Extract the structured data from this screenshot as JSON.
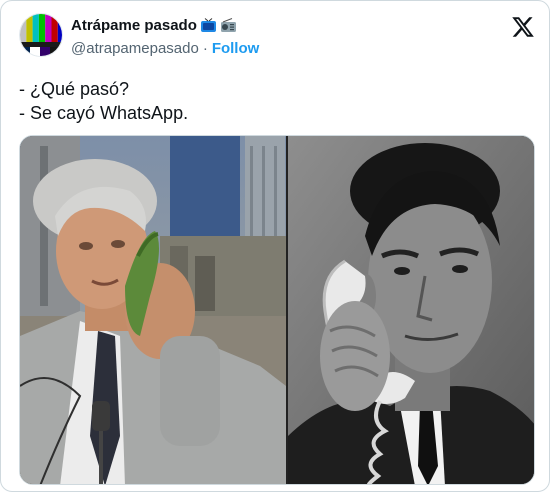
{
  "tweet": {
    "display_name": "Atrápame pasado",
    "name_emojis": [
      "tv-emoji",
      "radio-emoji"
    ],
    "handle": "@atrapamepasado",
    "separator": "·",
    "follow_label": "Follow",
    "lines": [
      "- ¿Qué pasó?",
      "- Se cayó WhatsApp."
    ]
  },
  "colors": {
    "accent": "#1d9bf0",
    "text": "#0f1419",
    "secondary": "#536471",
    "border": "#cfd9de"
  },
  "icons": {
    "brand": "x-logo-icon"
  }
}
